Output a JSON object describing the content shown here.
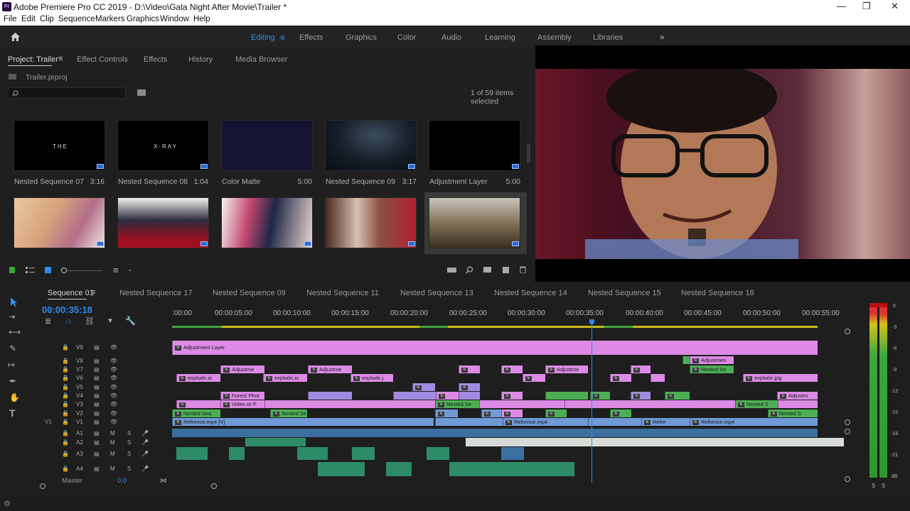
{
  "window": {
    "title": "Adobe Premiere Pro CC 2019 - D:\\Video\\Gala Night After Movie\\Trailer *",
    "logo": "Pr"
  },
  "menu": [
    "File",
    "Edit",
    "Clip",
    "Sequence",
    "Markers",
    "Graphics",
    "Window",
    "Help"
  ],
  "workspaces": [
    {
      "label": "Editing",
      "active": true
    },
    {
      "label": "Effects"
    },
    {
      "label": "Graphics"
    },
    {
      "label": "Color"
    },
    {
      "label": "Audio"
    },
    {
      "label": "Learning"
    },
    {
      "label": "Assembly"
    },
    {
      "label": "Libraries"
    }
  ],
  "project": {
    "tabs": [
      "Project: Trailer",
      "Effect Controls",
      "Effects",
      "History",
      "Media Browser"
    ],
    "file": "Trailer.prproj",
    "selection": "1 of 59 items selected",
    "row1": [
      {
        "name": "Nested Sequence 07",
        "dur": "3:16",
        "inner": "THE"
      },
      {
        "name": "Nested Sequence 08",
        "dur": "1:04",
        "inner": "X-RAY"
      },
      {
        "name": "Color Matte",
        "dur": "5:00"
      },
      {
        "name": "Nested Sequence 09",
        "dur": "3:17"
      },
      {
        "name": "Adjustment Layer",
        "dur": "5:00"
      }
    ]
  },
  "timeline": {
    "tabs": [
      "Sequence 01",
      "Nested Sequence 17",
      "Nested Sequence 09",
      "Nested Sequence 11",
      "Nested Sequence 13",
      "Nested Sequence 14",
      "Nested Sequence 15",
      "Nested Sequence 18"
    ],
    "timecode": "00:00:35:18",
    "ticks": [
      ":00:00",
      "00:00:05:00",
      "00:00:10:00",
      "00:00:15:00",
      "00:00:20:00",
      "00:00:25:00",
      "00:00:30:00",
      "00:00:35:00",
      "00:00:40:00",
      "00:00:45:00",
      "00:00:50:00",
      "00:00:55:00"
    ],
    "video_tracks": [
      "V9",
      "V8",
      "V7",
      "V6",
      "V5",
      "V4",
      "V3",
      "V2",
      "V1"
    ],
    "audio_tracks": [
      "A1",
      "A2",
      "A3",
      "A4"
    ],
    "source_patch": "V1",
    "master_label": "Master",
    "master_value": "0.0",
    "clips": {
      "adjustment_layer": "Adjustment Layer",
      "adjust": "Adjustme",
      "adjust_v8": "Adjustmen",
      "explode": "explode.io",
      "explode2": "explode.j",
      "explode3": "explode.jpg",
      "forest": "Forest Phot",
      "video": "Video or P",
      "nested": "Nested Seq",
      "nested2": "Nested Se",
      "nested3": "Nested S",
      "adjustm": "Adjustm",
      "ref": "Refrence.mp4 [V]",
      "ref2": "Refrence.mp4",
      "ref3": "Refre"
    }
  },
  "meters": {
    "labels": [
      "0",
      "-3",
      "-6",
      "-9",
      "-12",
      "-15",
      "-18",
      "-21",
      "dB"
    ],
    "solo": [
      "S",
      "S"
    ]
  }
}
